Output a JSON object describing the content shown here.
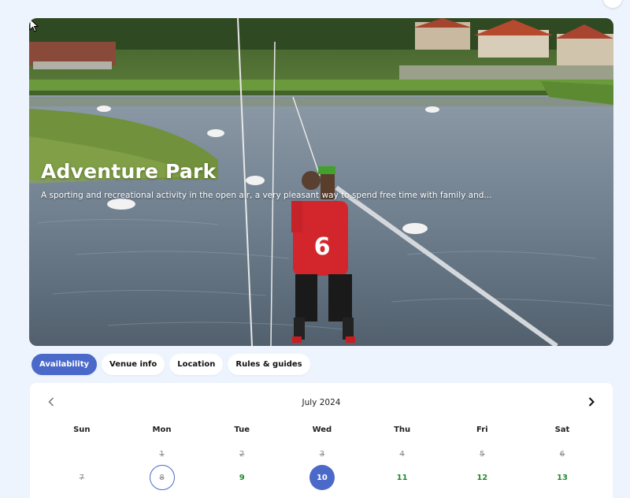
{
  "hero": {
    "title": "Adventure Park",
    "description": "A sporting and recreational activity in the open air, a very pleasant way to spend free time with family and..."
  },
  "tabs": [
    {
      "label": "Availability",
      "active": true
    },
    {
      "label": "Venue info",
      "active": false
    },
    {
      "label": "Location",
      "active": false
    },
    {
      "label": "Rules & guides",
      "active": false
    }
  ],
  "calendar": {
    "month_label": "July 2024",
    "weekdays": [
      "Sun",
      "Mon",
      "Tue",
      "Wed",
      "Thu",
      "Fri",
      "Sat"
    ],
    "week1": [
      "",
      "1",
      "2",
      "3",
      "4",
      "5",
      "6"
    ],
    "week2": [
      "7",
      "8",
      "9",
      "10",
      "11",
      "12",
      "13"
    ],
    "prev_icon": "chevron-left-icon",
    "next_icon": "chevron-right-icon"
  },
  "colors": {
    "accent": "#4a69c9",
    "available": "#1f8b2e",
    "background": "#eef4fd"
  }
}
